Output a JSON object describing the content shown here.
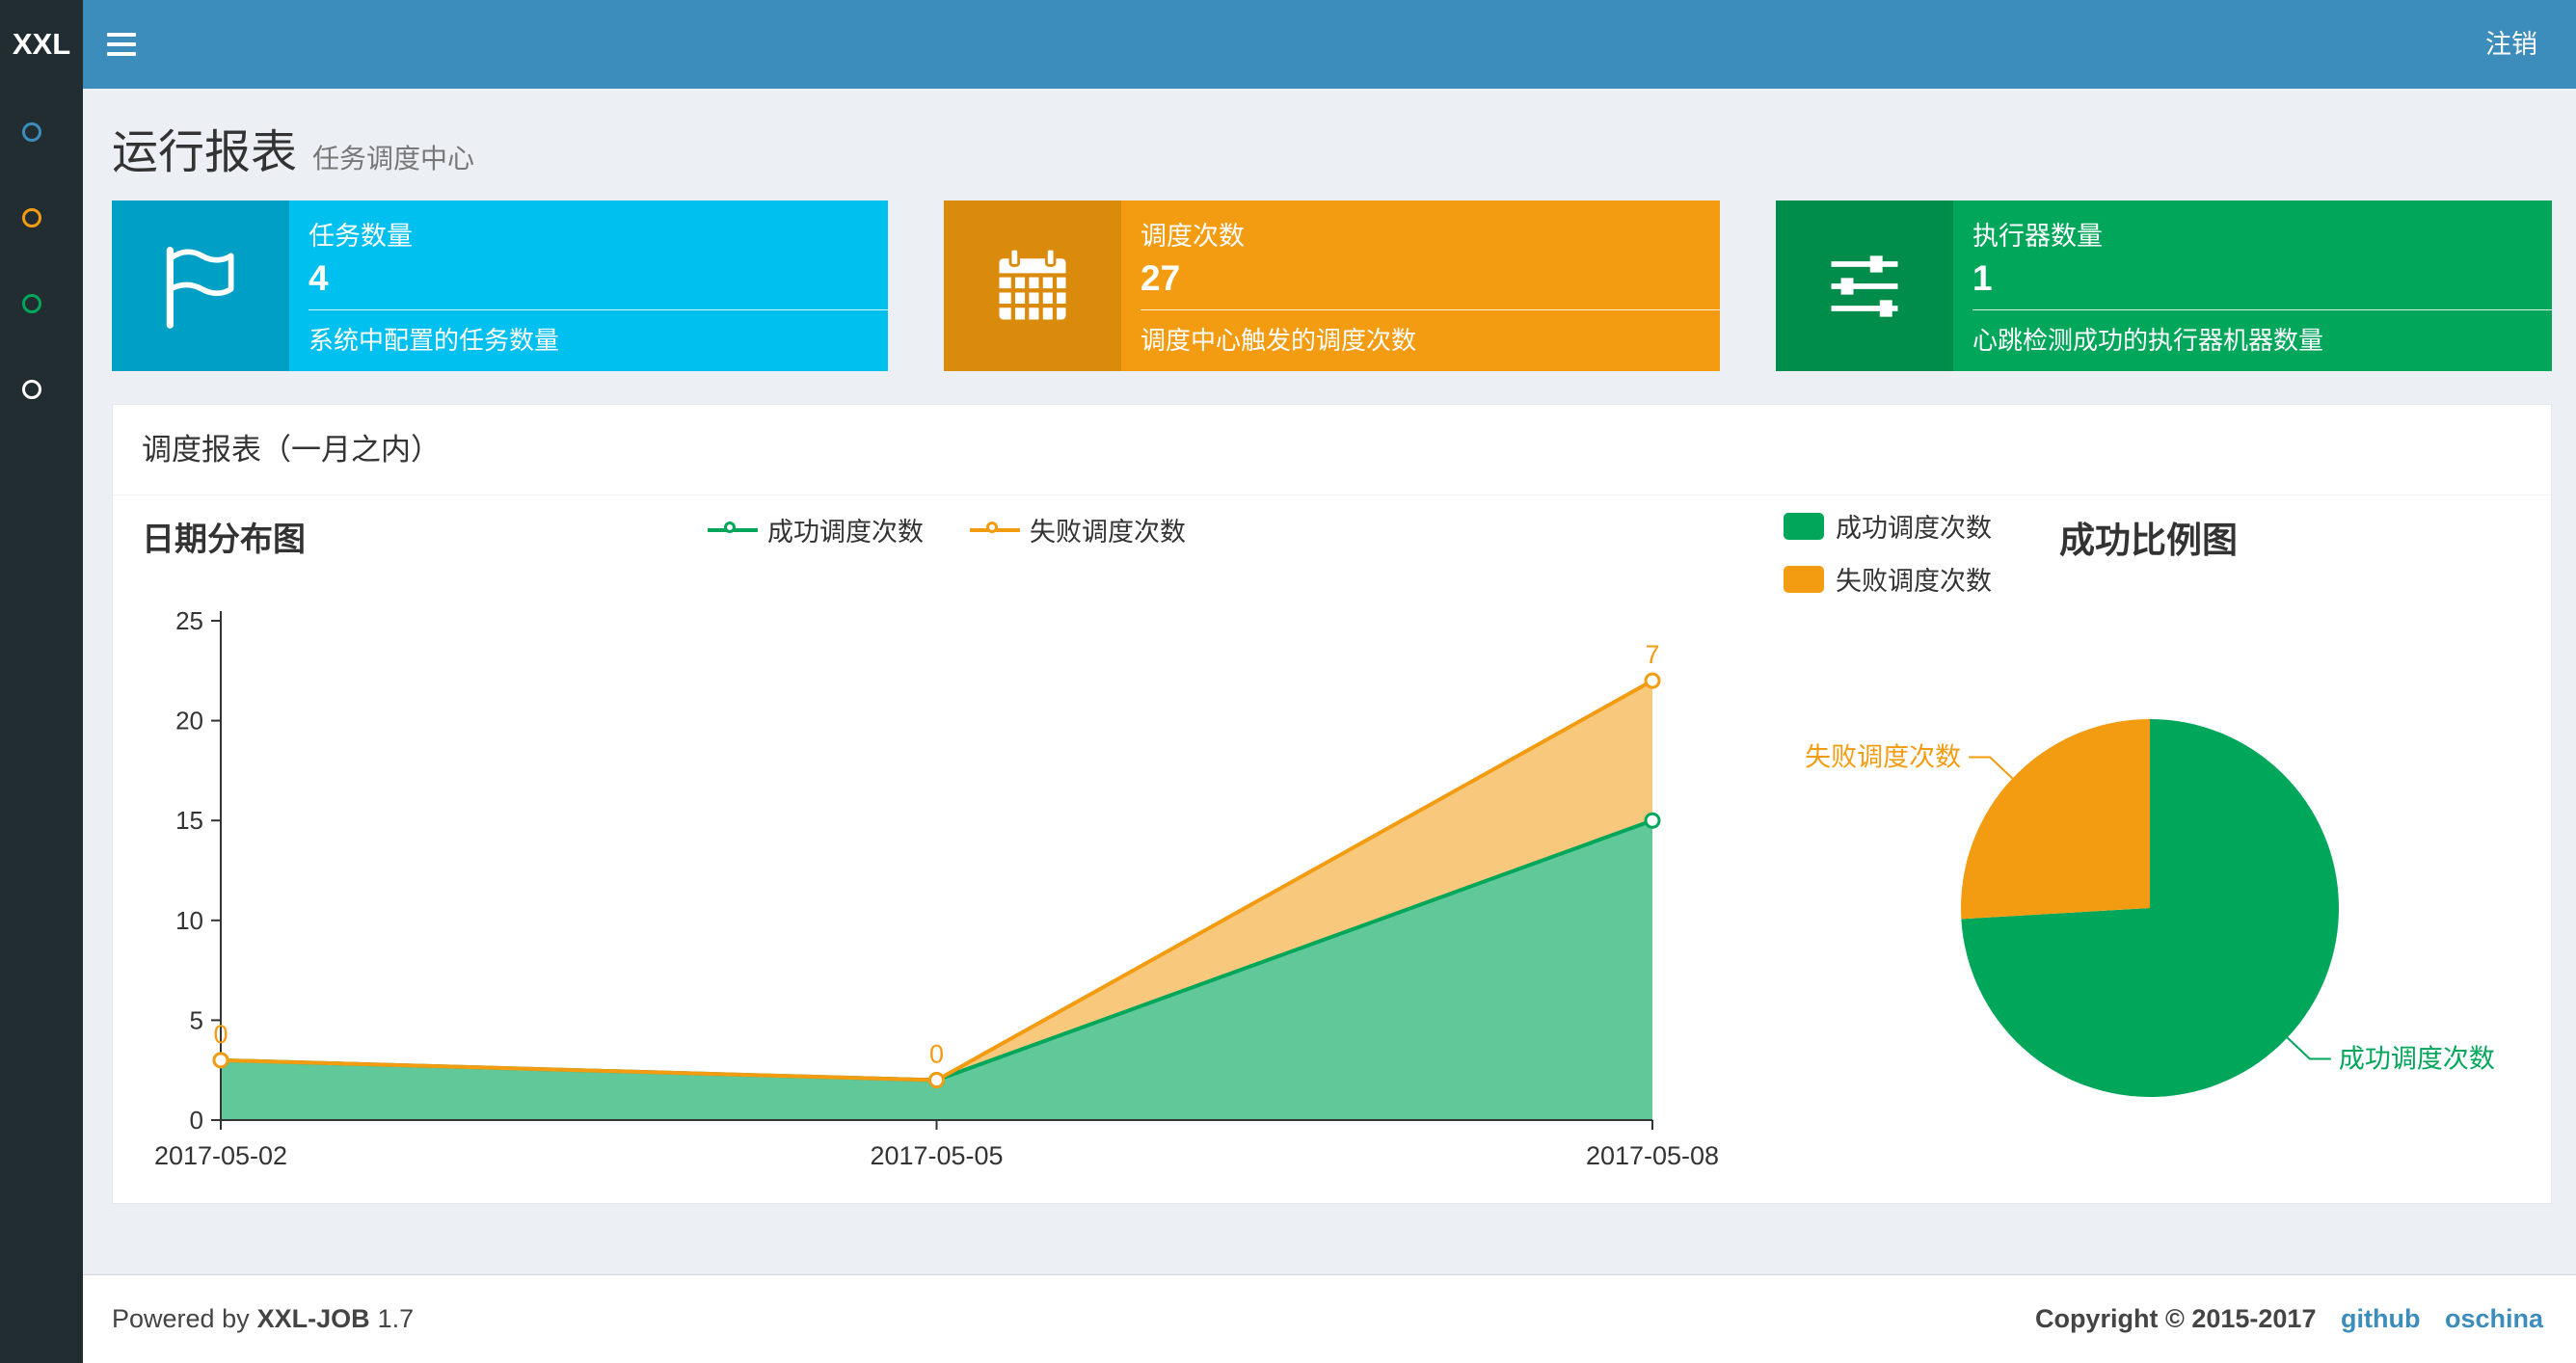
{
  "navbar": {
    "logo": "XXL",
    "logout_label": "注销"
  },
  "sidebar": {
    "items": [
      {
        "name": "sidebar-item-1",
        "icon": "circle-icon",
        "color": "#3c8dbc"
      },
      {
        "name": "sidebar-item-2",
        "icon": "circle-icon",
        "color": "#f39c12"
      },
      {
        "name": "sidebar-item-3",
        "icon": "circle-icon",
        "color": "#00a65a"
      },
      {
        "name": "sidebar-item-4",
        "icon": "circle-icon",
        "color": "#ffffff"
      }
    ]
  },
  "header": {
    "title": "运行报表",
    "subtitle": "任务调度中心"
  },
  "info_boxes": [
    {
      "title": "任务数量",
      "value": "4",
      "desc": "系统中配置的任务数量",
      "icon": "flag-icon",
      "color": "#00c0ef",
      "icon_bg": "#00a0c6"
    },
    {
      "title": "调度次数",
      "value": "27",
      "desc": "调度中心触发的调度次数",
      "icon": "calendar-icon",
      "color": "#f39c12",
      "icon_bg": "#db8b0b"
    },
    {
      "title": "执行器数量",
      "value": "1",
      "desc": "心跳检测成功的执行器机器数量",
      "icon": "sliders-icon",
      "color": "#00a65a",
      "icon_bg": "#008d4c"
    }
  ],
  "panel": {
    "title": "调度报表（一月之内）"
  },
  "chart_data": [
    {
      "type": "area",
      "title": "日期分布图",
      "x": [
        "2017-05-02",
        "2017-05-05",
        "2017-05-08"
      ],
      "series": [
        {
          "name": "成功调度次数",
          "color": "#00a65a",
          "values": [
            3,
            2,
            15
          ]
        },
        {
          "name": "失败调度次数",
          "color": "#f39c12",
          "values": [
            0,
            0,
            7
          ],
          "point_labels": [
            "0",
            "0",
            "7"
          ]
        }
      ],
      "stacked": true,
      "ylim": [
        0,
        25
      ],
      "yticks": [
        0,
        5,
        10,
        15,
        20,
        25
      ],
      "legend_position": "top",
      "grid": false
    },
    {
      "type": "pie",
      "title": "成功比例图",
      "slices": [
        {
          "name": "成功调度次数",
          "value": 20,
          "color": "#00a65a"
        },
        {
          "name": "失败调度次数",
          "value": 7,
          "color": "#f39c12"
        }
      ],
      "legend_position": "top-left"
    }
  ],
  "footer": {
    "powered_prefix": "Powered by",
    "app_name": "XXL-JOB",
    "version": "1.7",
    "copyright": "Copyright © 2015-2017",
    "links": [
      "github",
      "oschina"
    ]
  }
}
